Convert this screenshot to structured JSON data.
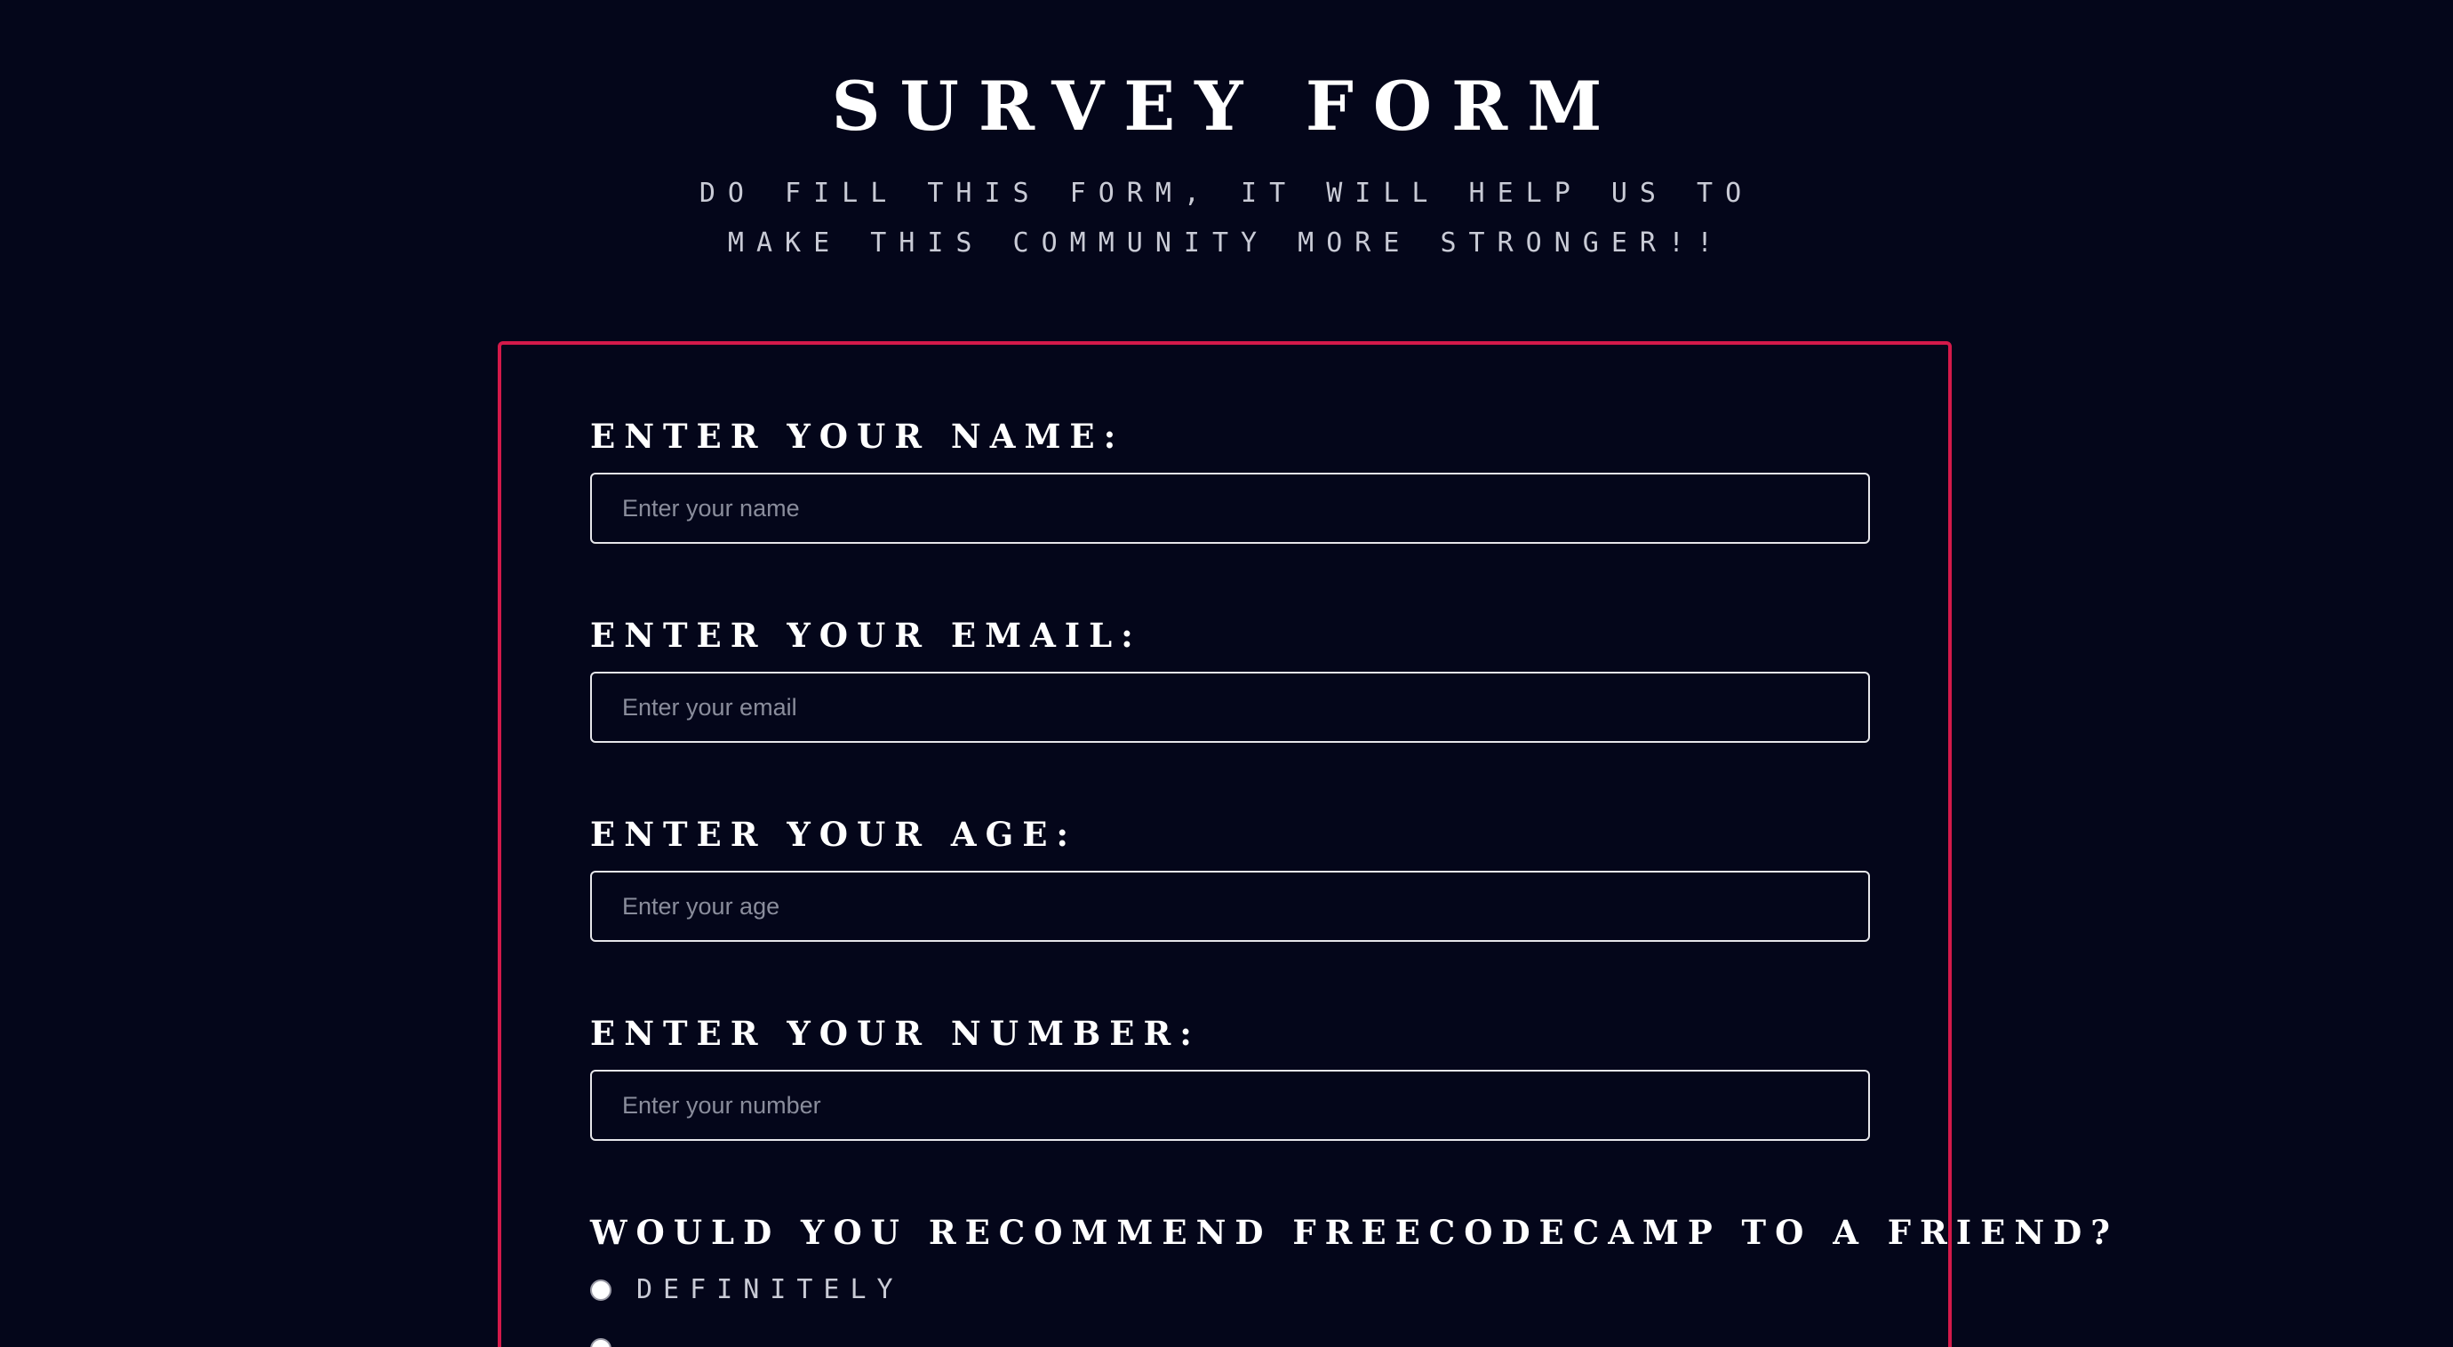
{
  "header": {
    "title": "Survey Form",
    "description": "Do fill this form, it will help us to make this community more stronger!!"
  },
  "form": {
    "fields": [
      {
        "label": "Enter your name:",
        "placeholder": "Enter your name"
      },
      {
        "label": "Enter your email:",
        "placeholder": "Enter your email"
      },
      {
        "label": "Enter your age:",
        "placeholder": "Enter your age"
      },
      {
        "label": "Enter your number:",
        "placeholder": "Enter your number"
      }
    ],
    "recommend": {
      "question": "Would you recommend freeCodeCamp to a friend?",
      "options": [
        {
          "label": "Definitely",
          "selected": false
        }
      ]
    }
  },
  "colors": {
    "background": "#04061a",
    "form_border": "#d4194a",
    "text": "#ffffff",
    "muted_text": "#c9cbd6"
  }
}
